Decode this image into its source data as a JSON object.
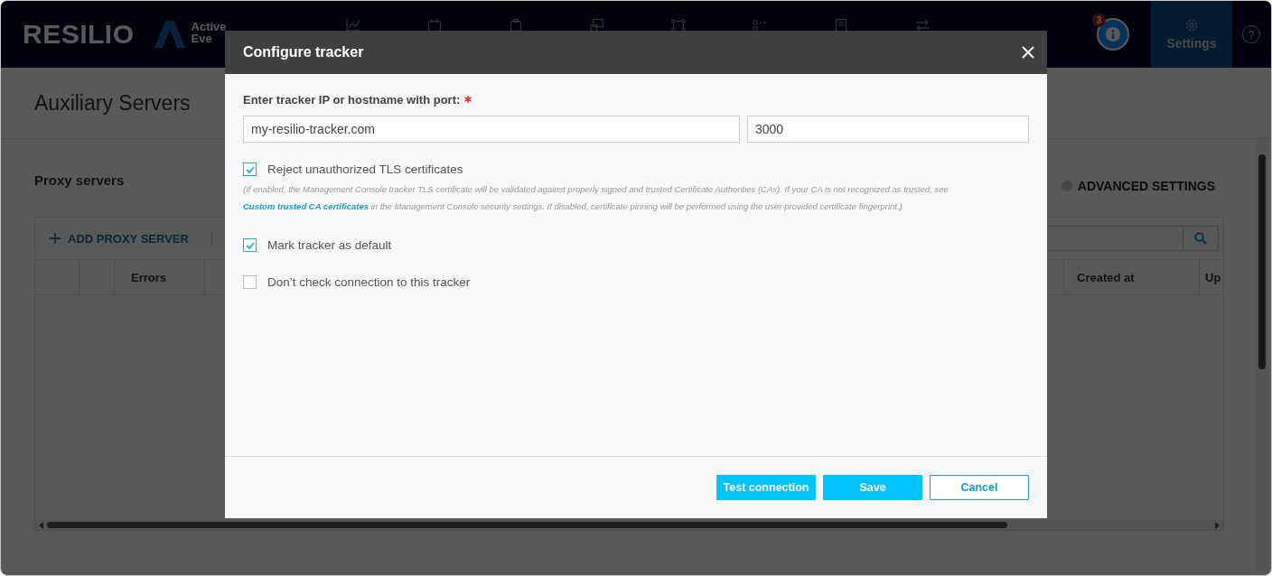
{
  "header": {
    "logo": "RESILIO",
    "brand_lines": [
      "Active",
      "Eve"
    ],
    "notification_count": "3",
    "settings_tab": {
      "label": "Settings",
      "selected": true
    },
    "help_glyph": "?"
  },
  "page": {
    "title": "Auxiliary Servers",
    "section_title": "Proxy servers",
    "advanced_settings": {
      "label": "ADVANCED SETTINGS",
      "on": false
    },
    "add_button": "ADD PROXY SERVER",
    "columns": [
      {
        "kind": "blank"
      },
      {
        "kind": "blank"
      },
      {
        "kind": "text",
        "label": "Errors"
      },
      {
        "kind": "blank"
      },
      {
        "kind": "text",
        "label": "Created at"
      },
      {
        "kind": "text",
        "label": "Up"
      }
    ]
  },
  "dialog": {
    "title": "Configure tracker",
    "field_label": "Enter tracker IP or hostname with port:",
    "required": true,
    "host": {
      "value": "my-resilio-tracker.com"
    },
    "port": {
      "value": "3000"
    },
    "options": [
      {
        "label": "Reject unauthorized TLS certificates",
        "checked": true,
        "note": {
          "before": "(If enabled, the Management Console tracker TLS certificate will be validated against properly signed and trusted Certificate Authorities (CAs).  If your CA is not recognized as trusted, see",
          "link": "Custom trusted CA certificates",
          "after": "in the Management Console security settings.  If disabled, certificate pinning will be performed using the user-provided certificate fingerprint.)"
        }
      },
      {
        "label": "Mark tracker as default",
        "checked": true
      },
      {
        "label": "Don’t check connection to this tracker",
        "checked": false
      }
    ],
    "buttons": [
      {
        "label": "Test connection",
        "kind": "primary"
      },
      {
        "label": "Save",
        "kind": "primary"
      },
      {
        "label": "Cancel",
        "kind": "secondary"
      }
    ]
  }
}
